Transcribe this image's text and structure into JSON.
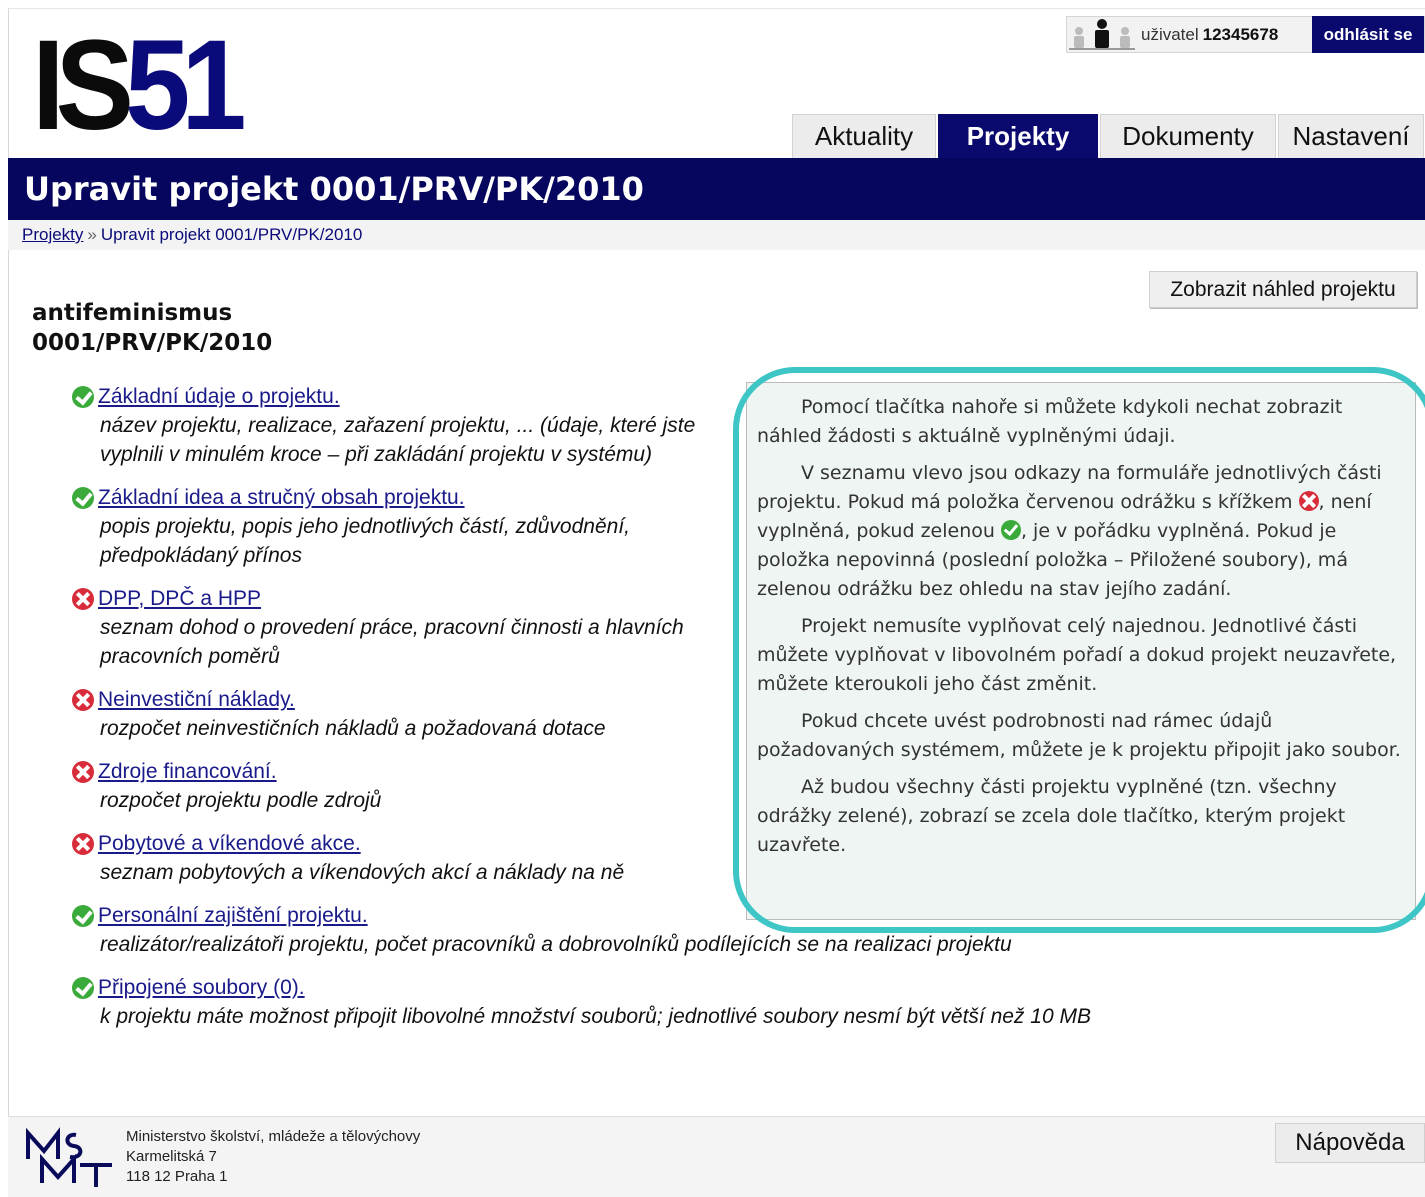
{
  "logo": {
    "part1": "IS",
    "part2": "51"
  },
  "user": {
    "label": "uživatel",
    "id": "12345678",
    "logout": "odhlásit se"
  },
  "tabs": [
    {
      "label": "Aktuality",
      "active": false
    },
    {
      "label": "Projekty",
      "active": true
    },
    {
      "label": "Dokumenty",
      "active": false
    },
    {
      "label": "Nastavení",
      "active": false
    }
  ],
  "page_title": "Upravit projekt 0001/PRV/PK/2010",
  "breadcrumb": {
    "link": "Projekty",
    "separator": "»",
    "current": "Upravit projekt 0001/PRV/PK/2010"
  },
  "preview_button": "Zobrazit náhled projektu",
  "project": {
    "name": "antifeminismus",
    "code": "0001/PRV/PK/2010"
  },
  "sections": [
    {
      "status": "ok",
      "title": "Základní údaje o projektu.",
      "desc": "název projektu, realizace, zařazení projektu, ... (údaje, které jste vyplnili v minulém kroce – při zakládání projektu v systému)"
    },
    {
      "status": "ok",
      "title": "Základní idea a stručný obsah projektu.",
      "desc": "popis projektu, popis jeho jednotlivých částí, zdůvodnění, předpokládaný přínos"
    },
    {
      "status": "bad",
      "title": "DPP, DPČ a HPP",
      "desc": "seznam dohod o provedení práce, pracovní činnosti a hlavních pracovních poměrů"
    },
    {
      "status": "bad",
      "title": "Neinvestiční náklady.",
      "desc": "rozpočet neinvestičních nákladů a požadovaná dotace"
    },
    {
      "status": "bad",
      "title": "Zdroje financování.",
      "desc": "rozpočet projektu podle zdrojů"
    },
    {
      "status": "bad",
      "title": "Pobytové a víkendové akce.",
      "desc": "seznam pobytových a víkendových akcí a náklady na ně"
    },
    {
      "status": "ok",
      "title": "Personální zajištění projektu.",
      "desc": "realizátor/realizátoři projektu, počet pracovníků a dobrovolníků podílejících se na realizaci projektu"
    },
    {
      "status": "ok",
      "title": "Připojené soubory (0).",
      "desc": "k projektu máte možnost připojit libovolné množství souborů; jednotlivé soubory nesmí být větší než 10 MB"
    }
  ],
  "info": {
    "p1": "Pomocí tlačítka nahoře si můžete kdykoli nechat zobrazit náhled žádosti s aktuálně vyplněnými údaji.",
    "p2a": "V seznamu vlevo jsou odkazy na formuláře jednotlivých části projektu. Pokud má položka červenou odrážku s křížkem",
    "p2b": ", není vyplněná, pokud zelenou",
    "p2c": ", je v pořádku vyplněná. Pokud je položka nepovinná (poslední položka – Přiložené soubory), má zelenou odrážku bez ohledu na stav jejího zadání.",
    "p3": "Projekt nemusíte vyplňovat celý najednou. Jednotlivé části můžete vyplňovat v libovolném pořadí a dokud projekt neuzavřete, můžete kteroukoli jeho část změnit.",
    "p4": "Pokud chcete uvést podrobnosti nad rámec údajů požadovaných systémem, můžete je k projektu připojit jako soubor.",
    "p5": "Až budou všechny části projektu vyplněné (tzn. všechny odrážky zelené), zobrazí se zcela dole tlačítko, kterým projekt uzavřete."
  },
  "footer": {
    "line1": "Ministerstvo školství, mládeže a tělovýchovy",
    "line2": "Karmelitská 7",
    "line3": "118 12 Praha 1",
    "help": "Nápověda"
  },
  "colors": {
    "navy": "#06065e",
    "ok": "#3aab3a",
    "bad": "#d92c3a",
    "highlight": "#3ec6c6"
  }
}
